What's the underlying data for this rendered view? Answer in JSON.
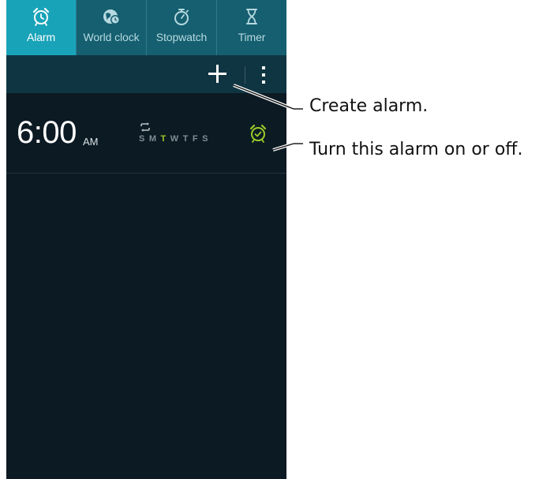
{
  "tabs": [
    {
      "label": "Alarm",
      "icon": "alarm-clock-icon",
      "active": true
    },
    {
      "label": "World clock",
      "icon": "globe-clock-icon",
      "active": false
    },
    {
      "label": "Stopwatch",
      "icon": "stopwatch-icon",
      "active": false
    },
    {
      "label": "Timer",
      "icon": "hourglass-icon",
      "active": false
    }
  ],
  "actionbar": {
    "add_icon": "plus-icon",
    "more_icon": "more-vertical-icon"
  },
  "alarm": {
    "time": "6:00",
    "ampm": "AM",
    "repeat_icon": "repeat-icon",
    "days": [
      {
        "letter": "S",
        "on": false
      },
      {
        "letter": "M",
        "on": false
      },
      {
        "letter": "T",
        "on": true
      },
      {
        "letter": "W",
        "on": false
      },
      {
        "letter": "T",
        "on": false
      },
      {
        "letter": "F",
        "on": false
      },
      {
        "letter": "S",
        "on": false
      }
    ],
    "toggle_icon": "alarm-clock-icon",
    "toggle_on": true
  },
  "callouts": {
    "create": "Create alarm.",
    "toggle": "Turn this alarm on or off."
  },
  "colors": {
    "screen_bg": "#0c1a23",
    "tab_bg": "#155f70",
    "tab_active": "#19a3b8",
    "actionbar_bg": "#103542",
    "accent_green": "#9ccc2a"
  }
}
